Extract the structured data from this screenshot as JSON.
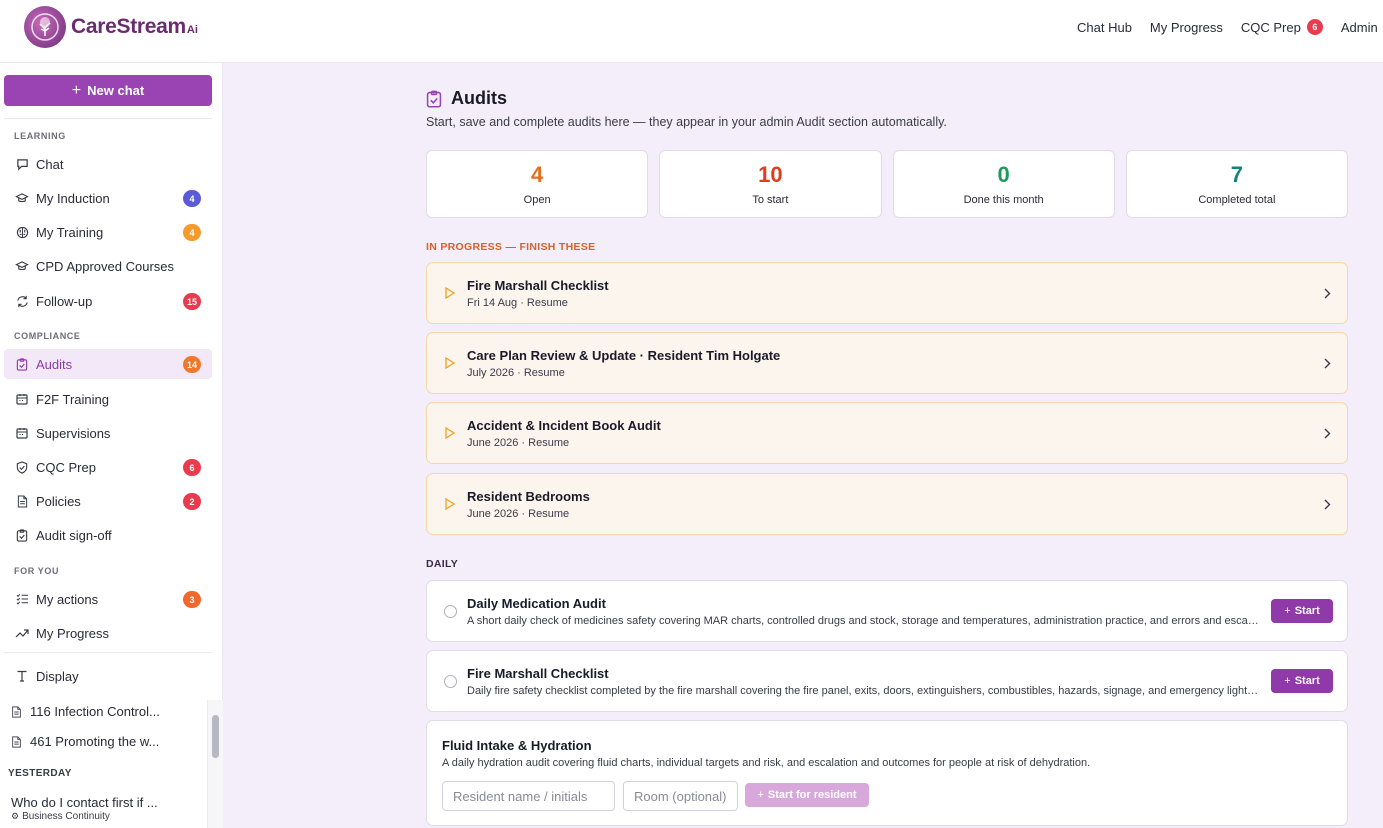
{
  "brand": {
    "name": "CareStream",
    "suffix": "Ai"
  },
  "topnav": {
    "items": [
      {
        "label": "Chat Hub"
      },
      {
        "label": "My Progress"
      },
      {
        "label": "CQC Prep",
        "badge": "6"
      },
      {
        "label": "Admin"
      }
    ]
  },
  "sidebar": {
    "new_chat": "New chat",
    "sections": {
      "learning": "LEARNING",
      "compliance": "COMPLIANCE",
      "for_you": "FOR YOU"
    },
    "items": [
      {
        "label": "Chat",
        "icon": "chat-bubble-icon"
      },
      {
        "label": "My Induction",
        "icon": "graduation-cap-icon",
        "badge": "4",
        "badge_color": "#5b5bd6"
      },
      {
        "label": "My Training",
        "icon": "brain-icon",
        "badge": "4",
        "badge_color": "#f59a2b"
      },
      {
        "label": "CPD Approved Courses",
        "icon": "graduation-cap-icon"
      },
      {
        "label": "Follow-up",
        "icon": "refresh-icon",
        "badge": "15",
        "badge_color": "#e93a4e"
      },
      {
        "label": "Audits",
        "icon": "clipboard-check-icon",
        "badge": "14",
        "badge_color": "#f0782c",
        "active": true
      },
      {
        "label": "F2F Training",
        "icon": "calendar-icon"
      },
      {
        "label": "Supervisions",
        "icon": "calendar-icon"
      },
      {
        "label": "CQC Prep",
        "icon": "shield-check-icon",
        "badge": "6",
        "badge_color": "#e93a4e"
      },
      {
        "label": "Policies",
        "icon": "document-icon",
        "badge": "2",
        "badge_color": "#e93a4e"
      },
      {
        "label": "Audit sign-off",
        "icon": "clipboard-check-icon"
      },
      {
        "label": "My actions",
        "icon": "checklist-icon",
        "badge": "3",
        "badge_color": "#f0682c"
      },
      {
        "label": "My Progress",
        "icon": "trend-up-icon"
      },
      {
        "label": "Display",
        "icon": "text-icon"
      }
    ],
    "recent": [
      {
        "label": "116 Infection Control..."
      },
      {
        "label": "461 Promoting the w..."
      }
    ],
    "yesterday_label": "YESTERDAY",
    "history": {
      "title": "Who do I contact first if ...",
      "subtitle": "Business Continuity"
    }
  },
  "main": {
    "title": "Audits",
    "subtitle": "Start, save and complete audits here — they appear in your admin Audit section automatically.",
    "stats": [
      {
        "value": "4",
        "label": "Open",
        "color": "#e0701f"
      },
      {
        "value": "10",
        "label": "To start",
        "color": "#d9401f"
      },
      {
        "value": "0",
        "label": "Done this month",
        "color": "#1f9a5a"
      },
      {
        "value": "7",
        "label": "Completed total",
        "color": "#12857a"
      }
    ],
    "in_progress_label": "IN PROGRESS — FINISH THESE",
    "in_progress": [
      {
        "title": "Fire Marshall Checklist",
        "meta": "Fri 14 Aug · Resume"
      },
      {
        "title": "Care Plan Review & Update · Resident Tim Holgate",
        "meta": "July 2026 · Resume"
      },
      {
        "title": "Accident & Incident Book Audit",
        "meta": "June 2026 · Resume"
      },
      {
        "title": "Resident Bedrooms",
        "meta": "June 2026 · Resume"
      }
    ],
    "daily_label": "DAILY",
    "daily": [
      {
        "title": "Daily Medication Audit",
        "desc": "A short daily check of medicines safety covering MAR charts, controlled drugs and stock, storage and temperatures, administration practice, and errors and escalation.",
        "button": "Start"
      },
      {
        "title": "Fire Marshall Checklist",
        "desc": "Daily fire safety checklist completed by the fire marshall covering the fire panel, exits, doors, extinguishers, combustibles, hazards, signage, and emergency lighting.",
        "button": "Start"
      }
    ],
    "fluid": {
      "title": "Fluid Intake & Hydration",
      "desc": "A daily hydration audit covering fluid charts, individual targets and risk, and escalation and outcomes for people at risk of dehydration.",
      "resident_placeholder": "Resident name / initials",
      "room_placeholder": "Room (optional)",
      "button": "Start for resident"
    }
  }
}
